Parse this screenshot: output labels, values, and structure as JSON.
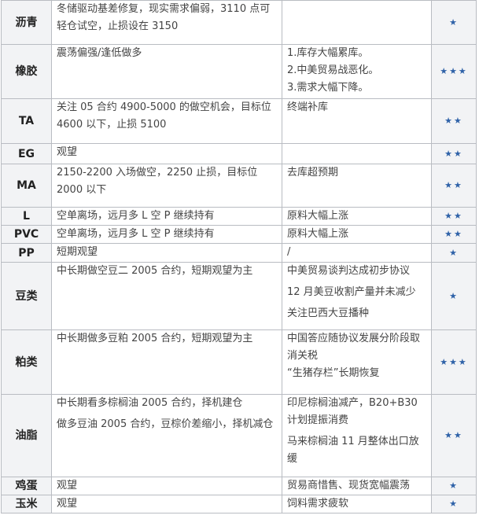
{
  "rows": [
    {
      "name": "沥青",
      "strategy": [
        "冬储驱动基差修复，现实需求偏弱，3110 点可轻仓试空，止损设在 3150"
      ],
      "reason": [],
      "rating": "★"
    },
    {
      "name": "橡胶",
      "strategy": [
        "震荡偏强/逢低做多"
      ],
      "reason": [
        "1.库存大幅累库。",
        "2.中美贸易战恶化。",
        "3.需求大幅下降。"
      ],
      "rating": "★★★"
    },
    {
      "name": "TA",
      "strategy": [
        "关注 05 合约 4900-5000 的做空机会，目标位 4600 以下，止损 5100"
      ],
      "reason": [
        "终端补库"
      ],
      "rating": "★★"
    },
    {
      "name": "EG",
      "strategy": [
        "观望"
      ],
      "reason": [],
      "rating": "★★"
    },
    {
      "name": "MA",
      "strategy": [
        "2150-2200 入场做空，2250 止损，目标位 2000 以下"
      ],
      "reason": [
        "去库超预期"
      ],
      "rating": "★★"
    },
    {
      "name": "L",
      "strategy": [
        "空单离场，远月多 L 空 P 继续持有"
      ],
      "reason": [
        "原料大幅上涨"
      ],
      "rating": "★★"
    },
    {
      "name": "PVC",
      "strategy": [
        "空单离场，远月多 L 空 P 继续持有"
      ],
      "reason": [
        "原料大幅上涨"
      ],
      "rating": "★★"
    },
    {
      "name": "PP",
      "strategy": [
        "短期观望"
      ],
      "reason": [
        "/"
      ],
      "rating": "★"
    },
    {
      "name": "豆类",
      "strategy": [
        "中长期做空豆二 2005 合约，短期观望为主"
      ],
      "reason": [
        "中美贸易谈判达成初步协议",
        "12 月美豆收割产量并未减少",
        "关注巴西大豆播种"
      ],
      "rating": "★"
    },
    {
      "name": "粕类",
      "strategy": [
        "中长期做多豆粕 2005 合约，短期观望为主"
      ],
      "reason": [
        "中国答应随协议发展分阶段取消关税",
        "“生猪存栏”长期恢复"
      ],
      "rating": "★★★"
    },
    {
      "name": "油脂",
      "strategy": [
        "中长期看多棕榈油 2005 合约，择机建仓",
        "做多豆油 2005 合约，豆棕价差缩小，择机减仓"
      ],
      "reason": [
        "印尼棕榈油减产，B20+B30 计划提振消费",
        "马来棕榈油 11 月整体出口放缓"
      ],
      "rating": "★★"
    },
    {
      "name": "鸡蛋",
      "strategy": [
        "观望"
      ],
      "reason": [
        "贸易商惜售、现货宽幅震荡"
      ],
      "rating": "★"
    },
    {
      "name": "玉米",
      "strategy": [
        "观望"
      ],
      "reason": [
        "饲料需求疲软"
      ],
      "rating": "★"
    }
  ]
}
